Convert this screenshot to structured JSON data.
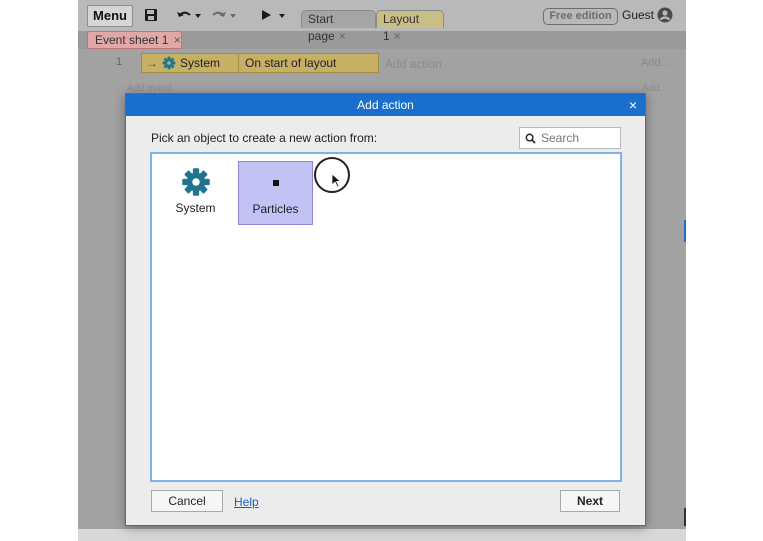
{
  "toolbar": {
    "menu_label": "Menu",
    "icons": [
      "save-icon",
      "undo-icon",
      "redo-icon",
      "play-icon"
    ],
    "tabs": [
      {
        "label": "Start page",
        "close": "×"
      },
      {
        "label": "Layout 1",
        "close": "×"
      }
    ],
    "edition_badge": "Free edition",
    "user_label": "Guest"
  },
  "event_sheet": {
    "tab_label": "Event sheet 1",
    "tab_close": "×",
    "row_number": "1",
    "condition_object": "System",
    "condition_text": "On start of layout",
    "add_action_label": "Add action",
    "add_more_label": "Add...",
    "add_event_label": "Add event",
    "add_more_label2": "Add..."
  },
  "dialog": {
    "title": "Add action",
    "close": "×",
    "prompt": "Pick an object to create a new action from:",
    "search_placeholder": "Search",
    "objects": [
      {
        "label": "System",
        "icon": "gear-icon",
        "selected": false
      },
      {
        "label": "Particles",
        "icon": "particles-icon",
        "selected": true
      }
    ],
    "cancel_label": "Cancel",
    "help_label": "Help",
    "next_label": "Next"
  },
  "colors": {
    "title_bar": "#1a6fcc",
    "gear": "#1f7490",
    "selection": "#c3c2f4",
    "condition": "#c5b066",
    "sheet_tab": "#e2a7a7"
  }
}
